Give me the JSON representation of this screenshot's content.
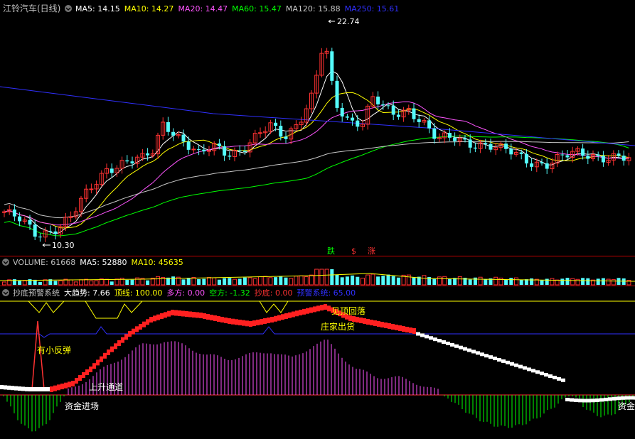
{
  "colors": {
    "up": "#ff3232",
    "down": "#54fcfc",
    "ma5": "#ffffff",
    "ma10": "#ffff00",
    "ma20": "#ff55ff",
    "ma60": "#00ff00",
    "ma120": "#c8c8c8",
    "ma250": "#3030ff",
    "divider": "#c00000",
    "label": "#c0c0c0"
  },
  "main_panel": {
    "title": "江铃汽车(日线)",
    "title_color": "#c0c0c0",
    "legend": [
      {
        "label": "MA5: 14.15",
        "color": "#ffffff"
      },
      {
        "label": "MA10: 14.27",
        "color": "#ffff00"
      },
      {
        "label": "MA20: 14.47",
        "color": "#ff55ff"
      },
      {
        "label": "MA60: 15.47",
        "color": "#00ff00"
      },
      {
        "label": "MA120: 15.88",
        "color": "#c8c8c8"
      },
      {
        "label": "MA250: 15.61",
        "color": "#3030ff"
      }
    ],
    "high_label": "22.74",
    "low_label": "10.30",
    "badges": [
      {
        "label": "跌",
        "color": "#00ff00"
      },
      {
        "label": "$",
        "color": "#ff3232"
      },
      {
        "label": "涨",
        "color": "#ff3232"
      }
    ]
  },
  "volume_panel": {
    "legend": [
      {
        "label": "VOLUME: 61668",
        "color": "#c0c0c0"
      },
      {
        "label": "MA5: 52880",
        "color": "#ffffff"
      },
      {
        "label": "MA10: 45635",
        "color": "#ffff00"
      }
    ]
  },
  "indicator_panel": {
    "legend": [
      {
        "label": "抄底预警系统",
        "color": "#c0c0c0"
      },
      {
        "label": "大趋势: 7.66",
        "color": "#ffffff"
      },
      {
        "label": "顶线: 100.00",
        "color": "#ffff00"
      },
      {
        "label": "多方: 0.00",
        "color": "#ff55ff"
      },
      {
        "label": "空方: -1.32",
        "color": "#00ff00"
      },
      {
        "label": "抄底: 0.00",
        "color": "#ff3232"
      },
      {
        "label": "预警系统: 65.00",
        "color": "#3030ff"
      }
    ],
    "annotations": {
      "rebound": "有小反弹",
      "uptrend": "上升通道",
      "inflow": "资金进场",
      "inflow_right": "资金",
      "top_fall": "见顶回落",
      "dealer_sell": "庄家出货"
    }
  }
}
